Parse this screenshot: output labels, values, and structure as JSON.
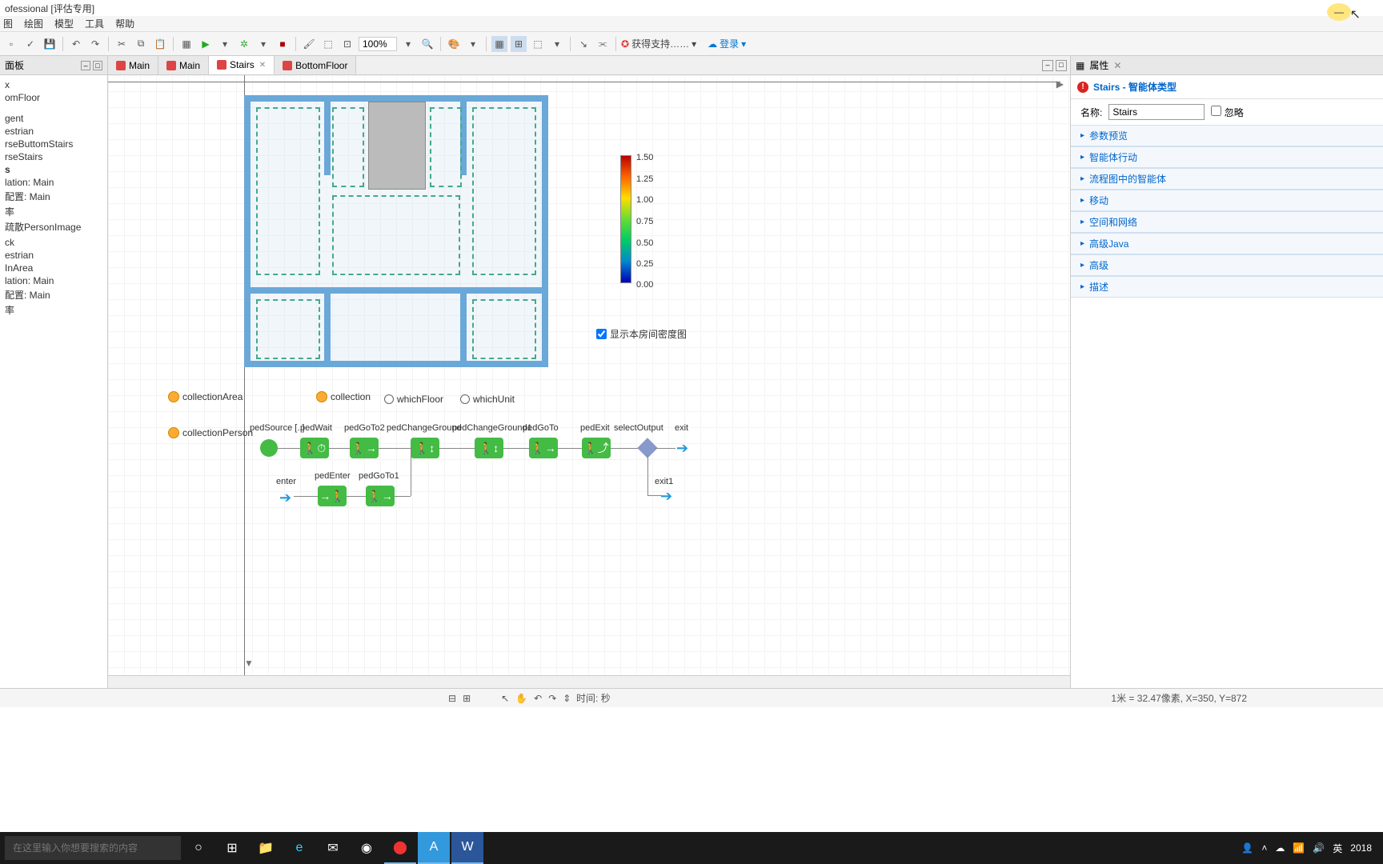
{
  "window": {
    "title": "ofessional [评估专用]"
  },
  "menu": {
    "items": [
      "图",
      "绘图",
      "模型",
      "工具",
      "帮助"
    ]
  },
  "toolbar": {
    "zoom": "100%",
    "support": "获得支持……",
    "login": "登录"
  },
  "sidebar": {
    "panel_title": "面板",
    "items": [
      "x",
      "omFloor",
      "gent",
      "estrian",
      "rseButtomStairs",
      "rseStairs",
      "s",
      "lation: Main",
      "配置: Main",
      "率",
      "疏散PersonImage",
      "",
      "ck",
      "estrian",
      "InArea",
      "lation: Main",
      "配置: Main",
      "率"
    ]
  },
  "editor": {
    "tabs": [
      {
        "label": "Main",
        "active": false
      },
      {
        "label": "Main",
        "active": false
      },
      {
        "label": "Stairs",
        "active": true
      },
      {
        "label": "BottomFloor",
        "active": false
      }
    ]
  },
  "legend": {
    "values": [
      "1.50",
      "1.25",
      "1.00",
      "0.75",
      "0.50",
      "0.25",
      "0.00"
    ]
  },
  "density_checkbox": "显示本房间密度图",
  "agents": {
    "collectionArea": "collectionArea",
    "collection": "collection",
    "whichFloor": "whichFloor",
    "whichUnit": "whichUnit",
    "collectionPerson": "collectionPerson"
  },
  "flow": {
    "pedSource": "pedSource [..]",
    "pedWait": "pedWait",
    "pedGoTo2": "pedGoTo2",
    "pedChangeGround": "pedChangeGround",
    "pedChangeGround1": "pedChangeGround1",
    "pedGoTo": "pedGoTo",
    "pedExit": "pedExit",
    "selectOutput": "selectOutput",
    "exit": "exit",
    "enter": "enter",
    "pedEnter": "pedEnter",
    "pedGoTo1": "pedGoTo1",
    "exit1": "exit1"
  },
  "properties": {
    "tab": "属性",
    "title": "Stairs - 智能体类型",
    "name_label": "名称:",
    "name_value": "Stairs",
    "ignore": "忽略",
    "sections": [
      "参数预览",
      "智能体行动",
      "流程图中的智能体",
      "移动",
      "空间和网络",
      "高级Java",
      "高级",
      "描述"
    ]
  },
  "status": {
    "time_label": "时间:",
    "time_unit": "秒",
    "scale": "1米 = 32.47像素, X=350,  Y=872"
  },
  "taskbar": {
    "search_placeholder": "在这里输入你想要搜索的内容",
    "ime": "英",
    "year": "2018"
  }
}
